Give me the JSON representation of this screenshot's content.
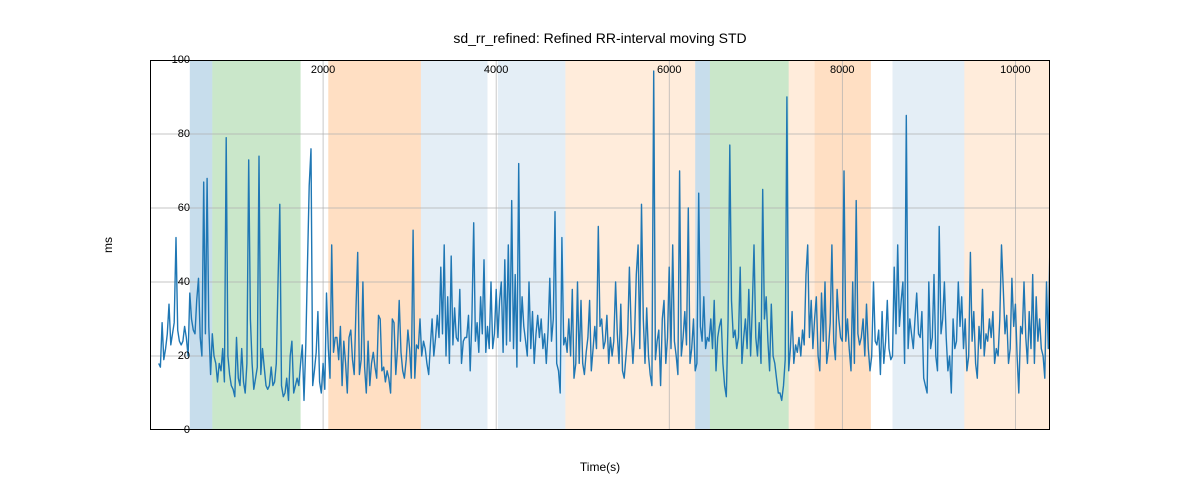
{
  "chart_data": {
    "type": "line",
    "title": "sd_rr_refined: Refined RR-interval moving STD",
    "xlabel": "Time(s)",
    "ylabel": "ms",
    "xlim": [
      0,
      10400
    ],
    "ylim": [
      0,
      100
    ],
    "xticks": [
      2000,
      4000,
      6000,
      8000,
      10000
    ],
    "yticks": [
      0,
      20,
      40,
      60,
      80,
      100
    ],
    "bands": [
      {
        "x0": 460,
        "x1": 720,
        "color": "blue"
      },
      {
        "x0": 720,
        "x1": 1740,
        "color": "green"
      },
      {
        "x0": 2060,
        "x1": 3130,
        "color": "orange"
      },
      {
        "x0": 3130,
        "x1": 3900,
        "color": "paleblue"
      },
      {
        "x0": 4020,
        "x1": 4800,
        "color": "paleblue"
      },
      {
        "x0": 4800,
        "x1": 5630,
        "color": "paleorange"
      },
      {
        "x0": 5630,
        "x1": 6300,
        "color": "paleorange"
      },
      {
        "x0": 6300,
        "x1": 6470,
        "color": "blue"
      },
      {
        "x0": 6470,
        "x1": 7380,
        "color": "green"
      },
      {
        "x0": 7380,
        "x1": 7680,
        "color": "paleorange"
      },
      {
        "x0": 7680,
        "x1": 8330,
        "color": "orange"
      },
      {
        "x0": 8580,
        "x1": 9410,
        "color": "paleblue"
      },
      {
        "x0": 9410,
        "x1": 10400,
        "color": "paleorange"
      }
    ],
    "series": [
      {
        "name": "sd_rr_refined",
        "x_step": 20,
        "x_start": 100,
        "values": [
          18,
          17,
          29,
          19,
          22,
          26,
          34,
          23,
          26,
          29,
          52,
          27,
          24,
          23,
          24,
          28,
          25,
          20,
          37,
          30,
          27,
          26,
          35,
          41,
          25,
          20,
          67,
          26,
          68,
          28,
          15,
          26,
          20,
          18,
          13,
          18,
          16,
          22,
          13,
          79,
          20,
          15,
          12,
          11,
          9,
          25,
          14,
          12,
          22,
          13,
          10,
          18,
          73,
          30,
          18,
          11,
          14,
          17,
          74,
          15,
          22,
          17,
          12,
          11,
          12,
          17,
          12,
          13,
          18,
          41,
          61,
          12,
          9,
          10,
          14,
          8,
          20,
          24,
          10,
          12,
          14,
          12,
          18,
          23,
          8,
          23,
          45,
          66,
          76,
          12,
          16,
          21,
          32,
          13,
          10,
          18,
          11,
          37,
          22,
          14,
          50,
          21,
          25,
          25,
          19,
          28,
          12,
          24,
          18,
          10,
          25,
          27,
          19,
          15,
          33,
          48,
          15,
          19,
          40,
          17,
          10,
          24,
          12,
          18,
          21,
          17,
          14,
          31,
          30,
          16,
          17,
          13,
          16,
          14,
          10,
          30,
          29,
          15,
          22,
          35,
          21,
          16,
          14,
          19,
          27,
          22,
          14,
          54,
          14,
          23,
          22,
          30,
          20,
          24,
          22,
          18,
          15,
          23,
          30,
          20,
          25,
          31,
          25,
          44,
          26,
          50,
          20,
          36,
          18,
          47,
          23,
          33,
          25,
          24,
          38,
          18,
          24,
          25,
          25,
          31,
          16,
          30,
          56,
          24,
          29,
          21,
          36,
          26,
          46,
          21,
          28,
          22,
          40,
          22,
          26,
          38,
          25,
          35,
          40,
          21,
          46,
          23,
          50,
          24,
          62,
          22,
          42,
          17,
          72,
          24,
          36,
          28,
          24,
          20,
          40,
          22,
          32,
          18,
          26,
          31,
          25,
          30,
          22,
          26,
          18,
          27,
          41,
          24,
          30,
          59,
          18,
          16,
          10,
          52,
          23,
          25,
          21,
          30,
          20,
          38,
          14,
          18,
          40,
          18,
          35,
          18,
          15,
          21,
          25,
          35,
          16,
          22,
          28,
          22,
          55,
          28,
          30,
          22,
          24,
          31,
          18,
          25,
          20,
          24,
          40,
          26,
          18,
          34,
          16,
          14,
          20,
          26,
          44,
          27,
          18,
          26,
          42,
          50,
          22,
          61,
          30,
          18,
          33,
          20,
          15,
          12,
          97,
          19,
          24,
          27,
          12,
          30,
          35,
          18,
          25,
          44,
          22,
          50,
          24,
          20,
          15,
          70,
          20,
          25,
          32,
          23,
          60,
          18,
          22,
          30,
          16,
          18,
          64,
          28,
          24,
          36,
          22,
          25,
          24,
          30,
          22,
          35,
          16,
          25,
          28,
          30,
          18,
          12,
          9,
          30,
          77,
          35,
          25,
          27,
          22,
          25,
          44,
          18,
          25,
          30,
          22,
          38,
          20,
          33,
          50,
          25,
          20,
          29,
          18,
          65,
          30,
          36,
          24,
          16,
          34,
          20,
          18,
          14,
          10,
          10,
          8,
          12,
          19,
          90,
          16,
          22,
          32,
          18,
          23,
          21,
          25,
          20,
          27,
          23,
          42,
          50,
          25,
          35,
          22,
          30,
          36,
          20,
          16,
          37,
          24,
          40,
          18,
          22,
          29,
          50,
          24,
          19,
          38,
          30,
          25,
          24,
          70,
          24,
          30,
          22,
          16,
          40,
          18,
          62,
          26,
          23,
          25,
          30,
          20,
          34,
          22,
          16,
          20,
          40,
          24,
          23,
          27,
          15,
          32,
          18,
          24,
          35,
          22,
          19,
          20,
          44,
          26,
          50,
          28,
          35,
          40,
          18,
          85,
          22,
          30,
          26,
          22,
          30,
          37,
          26,
          25,
          32,
          14,
          12,
          10,
          40,
          22,
          25,
          42,
          20,
          16,
          55,
          26,
          30,
          40,
          25,
          16,
          20,
          10,
          30,
          22,
          24,
          40,
          28,
          36,
          22,
          30,
          16,
          20,
          48,
          24,
          32,
          18,
          14,
          28,
          22,
          38,
          20,
          26,
          24,
          30,
          25,
          32,
          18,
          22,
          20,
          30,
          50,
          38,
          26,
          31,
          18,
          22,
          41,
          28,
          34,
          20,
          10,
          28,
          26,
          40,
          25,
          18,
          32,
          22,
          42,
          18,
          36,
          24,
          30,
          22,
          20,
          14,
          40,
          22,
          52
        ]
      }
    ]
  }
}
